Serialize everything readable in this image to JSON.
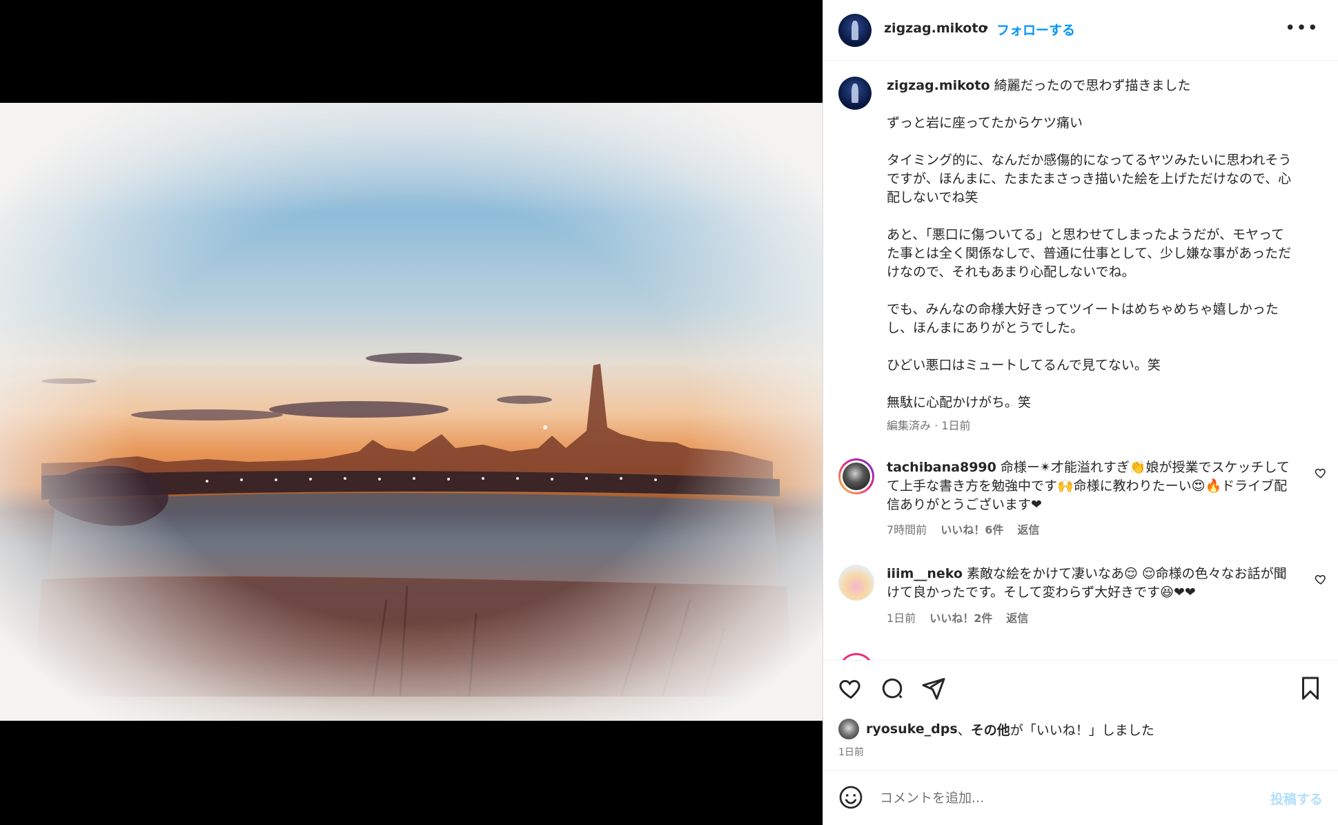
{
  "post": {
    "username": "zigzag.mikoto",
    "separator": "•",
    "follow_label": "フォローする",
    "more_label": "•••"
  },
  "caption": {
    "username": "zigzag.mikoto",
    "text": "綺麗だったので思わず描きました\n\nずっと岩に座ってたからケツ痛い\n\nタイミング的に、なんだか感傷的になってるヤツみたいに思われそうですが、ほんまに、たまたまさっき描いた絵を上げただけなので、心配しないでね笑\n\nあと、「悪口に傷ついてる」と思わせてしまったようだが、モヤってた事とは全く関係なしで、普通に仕事として、少し嫌な事があっただけなので、それもあまり心配しないでね。\n\nでも、みんなの命様大好きってツイートはめちゃめちゃ嬉しかったし、ほんまにありがとうでした。\n\nひどい悪口はミュートしてるんで見てない。笑\n\n無駄に心配かけがち。笑",
    "meta": "編集済み · 1日前"
  },
  "comments": [
    {
      "username": "tachibana8990",
      "text": " 命様ー✴︎才能溢れすぎ👏娘が授業でスケッチしてて上手な書き方を勉強中です🙌命様に教わりたーい😍🔥ドライブ配信ありがとうございます❤︎",
      "time": "7時間前",
      "likes": "いいね！6件",
      "reply": "返信"
    },
    {
      "username": "iiim__neko",
      "text": " 素敵な絵をかけて凄いなあ😌 😌命様の色々なお話が聞けて良かったです。そして変わらず大好きです😆❤︎❤︎",
      "time": "1日前",
      "likes": "いいね！2件",
      "reply": "返信"
    }
  ],
  "likes_line": {
    "user": "ryosuke_dps",
    "sep": "、",
    "others": "その他",
    "suffix": "が「いいね！」しました",
    "date": "1日前"
  },
  "input": {
    "placeholder": "コメントを追加...",
    "post_label": "投稿する"
  },
  "colors": {
    "accent": "#0095f6",
    "post_disabled": "#b2dffc",
    "muted": "#737373"
  },
  "icons": [
    "heart-icon",
    "comment-icon",
    "share-icon",
    "bookmark-icon",
    "emoji-icon",
    "more-icon"
  ]
}
